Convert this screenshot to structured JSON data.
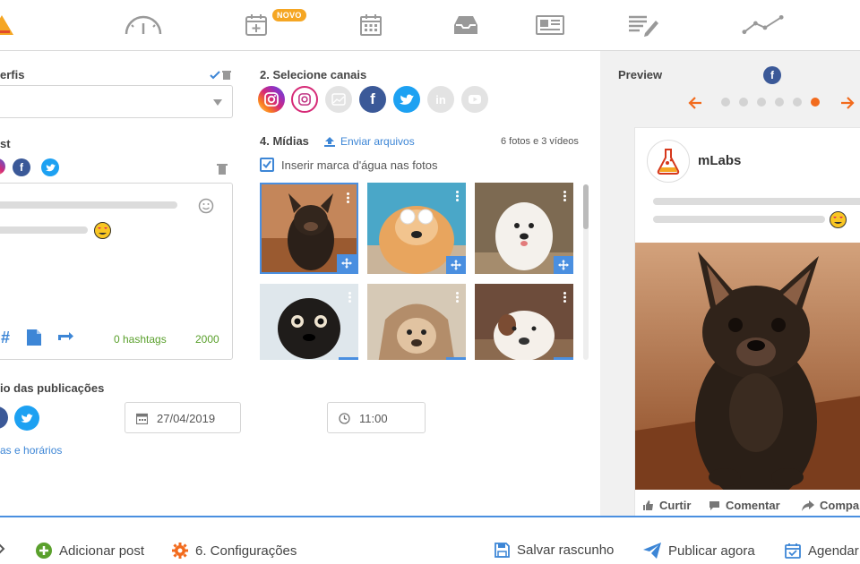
{
  "nav": {
    "new_badge": "NOVO"
  },
  "left": {
    "profiles_title": "erfis",
    "post_title": "st",
    "hashtags": "0 hashtags",
    "char_count": "2000",
    "schedule_title": "io das publicações",
    "date": "27/04/2019",
    "time": "11:00",
    "times_link": "as e horários"
  },
  "middle": {
    "channels_title": "2. Selecione canais",
    "media_title": "4. Mídias",
    "upload_label": "Enviar arquivos",
    "media_count": "6 fotos e 3 vídeos",
    "watermark_label": "Inserir marca d'água nas fotos"
  },
  "preview": {
    "title": "Preview",
    "account_name": "mLabs",
    "like": "Curtir",
    "comment": "Comentar",
    "share": "Compa",
    "dots_total": 6,
    "dots_active_index": 5
  },
  "bottom": {
    "add_post": "Adicionar post",
    "settings": "6. Configurações",
    "save_draft": "Salvar rascunho",
    "publish_now": "Publicar agora",
    "schedule": "Agendar"
  },
  "colors": {
    "accent": "#4a8fe0",
    "orange": "#f26b1d",
    "badge": "#f5a623",
    "facebook": "#3b5998",
    "twitter": "#1da1f2",
    "green": "#5aa02c"
  }
}
